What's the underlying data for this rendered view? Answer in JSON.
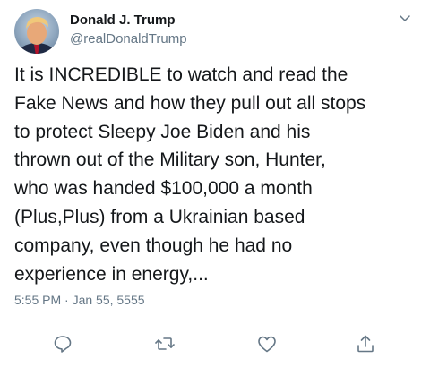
{
  "user": {
    "display_name": "Donald J. Trump",
    "handle": "@realDonaldTrump",
    "avatar_icon": "profile-photo"
  },
  "tweet": {
    "text": "It is INCREDIBLE to watch and read the\nFake News and how they pull out all stops\nto protect Sleepy Joe Biden and his\nthrown out of the Military son, Hunter,\nwho was handed $100,000 a month\n(Plus,Plus) from a Ukrainian based\ncompany, even though he had no\nexperience in energy,...",
    "timestamp": "5:55 PM · Jan 55, 5555"
  },
  "actions": [
    {
      "name": "reply",
      "icon": "speech-bubble-icon"
    },
    {
      "name": "retweet",
      "icon": "retweet-icon"
    },
    {
      "name": "like",
      "icon": "heart-icon"
    },
    {
      "name": "share",
      "icon": "share-icon"
    }
  ],
  "colors": {
    "text_primary": "#14171a",
    "text_secondary": "#657786",
    "divider": "#e1e8ed",
    "icon": "#657786"
  }
}
